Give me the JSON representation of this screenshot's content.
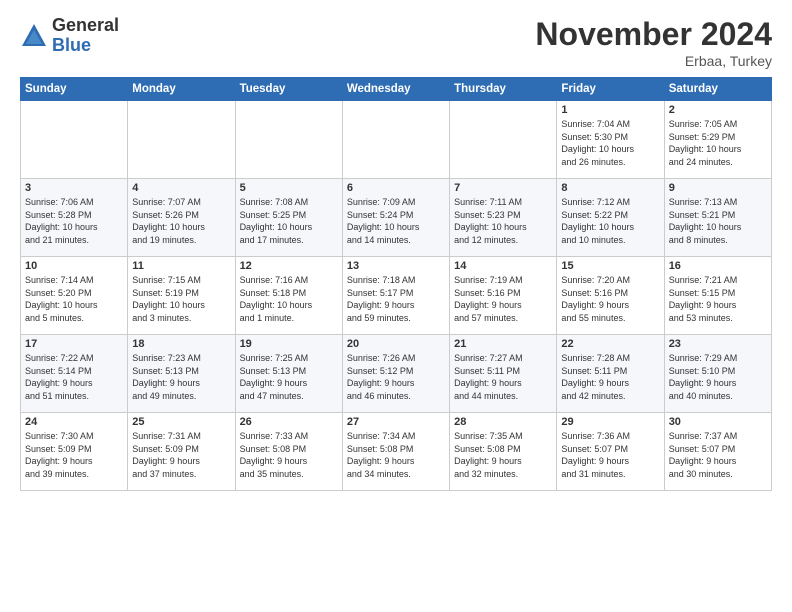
{
  "header": {
    "logo_general": "General",
    "logo_blue": "Blue",
    "month_title": "November 2024",
    "location": "Erbaa, Turkey"
  },
  "days_of_week": [
    "Sunday",
    "Monday",
    "Tuesday",
    "Wednesday",
    "Thursday",
    "Friday",
    "Saturday"
  ],
  "weeks": [
    [
      {
        "day": "",
        "info": ""
      },
      {
        "day": "",
        "info": ""
      },
      {
        "day": "",
        "info": ""
      },
      {
        "day": "",
        "info": ""
      },
      {
        "day": "",
        "info": ""
      },
      {
        "day": "1",
        "info": "Sunrise: 7:04 AM\nSunset: 5:30 PM\nDaylight: 10 hours\nand 26 minutes."
      },
      {
        "day": "2",
        "info": "Sunrise: 7:05 AM\nSunset: 5:29 PM\nDaylight: 10 hours\nand 24 minutes."
      }
    ],
    [
      {
        "day": "3",
        "info": "Sunrise: 7:06 AM\nSunset: 5:28 PM\nDaylight: 10 hours\nand 21 minutes."
      },
      {
        "day": "4",
        "info": "Sunrise: 7:07 AM\nSunset: 5:26 PM\nDaylight: 10 hours\nand 19 minutes."
      },
      {
        "day": "5",
        "info": "Sunrise: 7:08 AM\nSunset: 5:25 PM\nDaylight: 10 hours\nand 17 minutes."
      },
      {
        "day": "6",
        "info": "Sunrise: 7:09 AM\nSunset: 5:24 PM\nDaylight: 10 hours\nand 14 minutes."
      },
      {
        "day": "7",
        "info": "Sunrise: 7:11 AM\nSunset: 5:23 PM\nDaylight: 10 hours\nand 12 minutes."
      },
      {
        "day": "8",
        "info": "Sunrise: 7:12 AM\nSunset: 5:22 PM\nDaylight: 10 hours\nand 10 minutes."
      },
      {
        "day": "9",
        "info": "Sunrise: 7:13 AM\nSunset: 5:21 PM\nDaylight: 10 hours\nand 8 minutes."
      }
    ],
    [
      {
        "day": "10",
        "info": "Sunrise: 7:14 AM\nSunset: 5:20 PM\nDaylight: 10 hours\nand 5 minutes."
      },
      {
        "day": "11",
        "info": "Sunrise: 7:15 AM\nSunset: 5:19 PM\nDaylight: 10 hours\nand 3 minutes."
      },
      {
        "day": "12",
        "info": "Sunrise: 7:16 AM\nSunset: 5:18 PM\nDaylight: 10 hours\nand 1 minute."
      },
      {
        "day": "13",
        "info": "Sunrise: 7:18 AM\nSunset: 5:17 PM\nDaylight: 9 hours\nand 59 minutes."
      },
      {
        "day": "14",
        "info": "Sunrise: 7:19 AM\nSunset: 5:16 PM\nDaylight: 9 hours\nand 57 minutes."
      },
      {
        "day": "15",
        "info": "Sunrise: 7:20 AM\nSunset: 5:16 PM\nDaylight: 9 hours\nand 55 minutes."
      },
      {
        "day": "16",
        "info": "Sunrise: 7:21 AM\nSunset: 5:15 PM\nDaylight: 9 hours\nand 53 minutes."
      }
    ],
    [
      {
        "day": "17",
        "info": "Sunrise: 7:22 AM\nSunset: 5:14 PM\nDaylight: 9 hours\nand 51 minutes."
      },
      {
        "day": "18",
        "info": "Sunrise: 7:23 AM\nSunset: 5:13 PM\nDaylight: 9 hours\nand 49 minutes."
      },
      {
        "day": "19",
        "info": "Sunrise: 7:25 AM\nSunset: 5:13 PM\nDaylight: 9 hours\nand 47 minutes."
      },
      {
        "day": "20",
        "info": "Sunrise: 7:26 AM\nSunset: 5:12 PM\nDaylight: 9 hours\nand 46 minutes."
      },
      {
        "day": "21",
        "info": "Sunrise: 7:27 AM\nSunset: 5:11 PM\nDaylight: 9 hours\nand 44 minutes."
      },
      {
        "day": "22",
        "info": "Sunrise: 7:28 AM\nSunset: 5:11 PM\nDaylight: 9 hours\nand 42 minutes."
      },
      {
        "day": "23",
        "info": "Sunrise: 7:29 AM\nSunset: 5:10 PM\nDaylight: 9 hours\nand 40 minutes."
      }
    ],
    [
      {
        "day": "24",
        "info": "Sunrise: 7:30 AM\nSunset: 5:09 PM\nDaylight: 9 hours\nand 39 minutes."
      },
      {
        "day": "25",
        "info": "Sunrise: 7:31 AM\nSunset: 5:09 PM\nDaylight: 9 hours\nand 37 minutes."
      },
      {
        "day": "26",
        "info": "Sunrise: 7:33 AM\nSunset: 5:08 PM\nDaylight: 9 hours\nand 35 minutes."
      },
      {
        "day": "27",
        "info": "Sunrise: 7:34 AM\nSunset: 5:08 PM\nDaylight: 9 hours\nand 34 minutes."
      },
      {
        "day": "28",
        "info": "Sunrise: 7:35 AM\nSunset: 5:08 PM\nDaylight: 9 hours\nand 32 minutes."
      },
      {
        "day": "29",
        "info": "Sunrise: 7:36 AM\nSunset: 5:07 PM\nDaylight: 9 hours\nand 31 minutes."
      },
      {
        "day": "30",
        "info": "Sunrise: 7:37 AM\nSunset: 5:07 PM\nDaylight: 9 hours\nand 30 minutes."
      }
    ]
  ]
}
